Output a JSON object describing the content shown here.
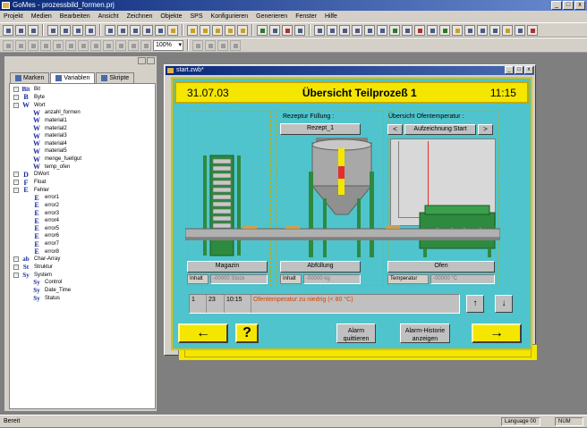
{
  "app": {
    "title": "GoMes - prozessbild_formen.prj",
    "window_buttons": [
      "_",
      "□",
      "x"
    ]
  },
  "menu": [
    "Projekt",
    "Medien",
    "Bearbeiten",
    "Ansicht",
    "Zeichnen",
    "Objekte",
    "SPS",
    "Konfigurieren",
    "Generieren",
    "Fenster",
    "Hilfe"
  ],
  "toolbar": {
    "zoom": "100%"
  },
  "tree_panel": {
    "tabs": [
      {
        "label": "Marken",
        "active": false
      },
      {
        "label": "Variablen",
        "active": true
      },
      {
        "label": "Skripte",
        "active": false
      }
    ],
    "nodes": [
      {
        "tag": "Bit",
        "text": "Bit",
        "expander": "-"
      },
      {
        "tag": "B",
        "text": "Byte",
        "expander": "-"
      },
      {
        "tag": "W",
        "text": "Wort",
        "expander": "-"
      },
      {
        "tag": "W",
        "text": "anzahl_formen",
        "indent": 1
      },
      {
        "tag": "W",
        "text": "material1",
        "indent": 1
      },
      {
        "tag": "W",
        "text": "material2",
        "indent": 1
      },
      {
        "tag": "W",
        "text": "material3",
        "indent": 1
      },
      {
        "tag": "W",
        "text": "material4",
        "indent": 1
      },
      {
        "tag": "W",
        "text": "material5",
        "indent": 1
      },
      {
        "tag": "W",
        "text": "menge_fuellgut",
        "indent": 1
      },
      {
        "tag": "W",
        "text": "temp_ofen",
        "indent": 1
      },
      {
        "tag": "D",
        "text": "DWort",
        "expander": "-"
      },
      {
        "tag": "F",
        "text": "Float",
        "expander": "-"
      },
      {
        "tag": "E",
        "text": "Fehler",
        "expander": "-"
      },
      {
        "tag": "E",
        "text": "error1",
        "indent": 1
      },
      {
        "tag": "E",
        "text": "error2",
        "indent": 1
      },
      {
        "tag": "E",
        "text": "error3",
        "indent": 1
      },
      {
        "tag": "E",
        "text": "error4",
        "indent": 1
      },
      {
        "tag": "E",
        "text": "error5",
        "indent": 1
      },
      {
        "tag": "E",
        "text": "error6",
        "indent": 1
      },
      {
        "tag": "E",
        "text": "error7",
        "indent": 1
      },
      {
        "tag": "E",
        "text": "error8",
        "indent": 1
      },
      {
        "tag": "ab",
        "text": "Char-Array",
        "expander": "-"
      },
      {
        "tag": "St",
        "text": "Struktur",
        "expander": "-"
      },
      {
        "tag": "Sy",
        "text": "System",
        "expander": "-"
      },
      {
        "tag": "Sy",
        "text": "Control",
        "indent": 1
      },
      {
        "tag": "Sy",
        "text": "Date_Time",
        "indent": 1
      },
      {
        "tag": "Sy",
        "text": "Status",
        "indent": 1
      }
    ]
  },
  "inner_window": {
    "title": "start.zwb*",
    "buttons": [
      "_",
      "□",
      "x"
    ]
  },
  "screen": {
    "date": "31.07.03",
    "title": "Übersicht Teilprozeß 1",
    "time": "11:15",
    "recipe_label": "Rezeptur Füllung :",
    "recipe_button": "Rezept_1",
    "oven_overview_label": "Übersicht Ofentemperatur :",
    "prev": "<",
    "record_start": "Aufzeichnung Start",
    "next": ">",
    "magazin_button": "Magazin",
    "abfuellung_button": "Abfüllung",
    "ofen_button": "Ofen",
    "inhalt1_label": "Inhalt",
    "inhalt1_value": "-00000 Stück",
    "inhalt2_label": "Inhalt",
    "inhalt2_value": "-00000 kg",
    "temperatur_label": "Temperatur",
    "temperatur_value": "-00000 °C",
    "alarm": {
      "col1": "1",
      "col2": "23",
      "time": "10:15",
      "message": "Ofentemperatur zu niedrig (< 80 °C)"
    },
    "up": "↑",
    "down": "↓",
    "back": "←",
    "help": "?",
    "alarm_ack": "Alarm quittieren",
    "alarm_history": "Alarm-Historie anzeigen",
    "forward": "→"
  },
  "status": {
    "left": "Bereit",
    "language": "Language 00",
    "num": "NUM"
  },
  "colors": {
    "screen_bg": "#50c4cc",
    "header_yellow": "#f5e600",
    "machine_green": "#2e8a3e",
    "alarm_text": "#e04000"
  }
}
